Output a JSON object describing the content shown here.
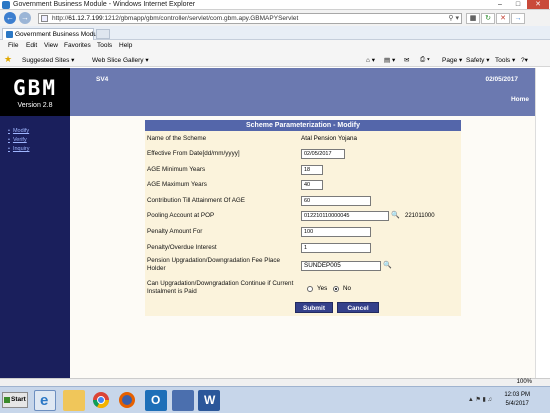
{
  "browser": {
    "window_title": "Government Business Module - Windows Internet Explorer",
    "url_prefix": "http://",
    "url_host": "61.12.7.199",
    "url_rest": ":1212/gbmapp/gbm/controller/servlet/com.gbm.apy.GBMAPYServlet",
    "tab_title": "Government Business Module",
    "menu": [
      "File",
      "Edit",
      "View",
      "Favorites",
      "Tools",
      "Help"
    ],
    "favorites": [
      "Suggested Sites ▾",
      "Web Slice Gallery ▾"
    ],
    "commands": [
      "Page ▾",
      "Safety ▾",
      "Tools ▾",
      "?▾"
    ],
    "zoom": "100%"
  },
  "app": {
    "logo": "GBM",
    "version": "Version 2.8",
    "module": "SV4",
    "date": "02/05/2017",
    "home_link": "Home",
    "sidebar": [
      "Modify",
      "Verify",
      "Inquiry"
    ]
  },
  "form": {
    "title": "Scheme Parameterization - Modify",
    "scheme_label": "Name of the Scheme",
    "scheme_value": "Atal Pension Yojana",
    "effective_from_label": "Effective From Date[dd/mm/yyyy]",
    "effective_from_value": "02/05/2017",
    "age_min_label": "AGE Minimum Years",
    "age_min_value": "18",
    "age_max_label": "AGE Maximum Years",
    "age_max_value": "40",
    "contrib_age_label": "Contribution Till Attainment Of AGE",
    "contrib_age_value": "60",
    "pooling_label": "Pooling Account at POP",
    "pooling_value": "012210110000045",
    "pooling_extra": "221011000",
    "penalty_amount_label": "Penalty Amount For",
    "penalty_amount_value": "100",
    "penalty_interest_label": "Penalty/Overdue Interest",
    "penalty_interest_value": "1",
    "fee_holder_label": "Pension Upgradation/Downgradation Fee Place Holder",
    "fee_holder_value": "SUNDEP005",
    "continue_label": "Can Upgradation/Downgradation Continue if Current Instalment is Paid",
    "yes_label": "Yes",
    "no_label": "No",
    "selected": "No",
    "submit_label": "Submit",
    "cancel_label": "Cancel"
  },
  "taskbar": {
    "start_label": "Start",
    "time": "12:03 PM",
    "date": "5/4/2017"
  }
}
